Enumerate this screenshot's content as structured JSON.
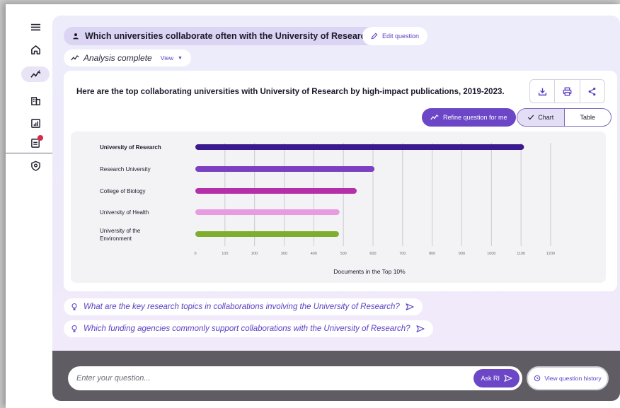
{
  "sidebar": {
    "items": [
      {
        "icon": "menu-icon"
      },
      {
        "icon": "home-icon"
      },
      {
        "icon": "analytics-icon",
        "active": true
      },
      {
        "icon": "institutions-icon"
      },
      {
        "icon": "reports-icon"
      },
      {
        "icon": "notifications-icon",
        "badge": true
      },
      {
        "icon": "support-icon"
      }
    ]
  },
  "question": {
    "text": "Which universities collaborate often with the University of Research?",
    "edit_label": "Edit question"
  },
  "analysis": {
    "status": "Analysis complete",
    "view_label": "View"
  },
  "card": {
    "title": "Here are the top collaborating universities with University of Research by high-impact publications, 2019-2023.",
    "refine_label": "Refine question for me",
    "toggle": {
      "chart_label": "Chart",
      "table_label": "Table",
      "selected": "Chart"
    }
  },
  "chart_data": {
    "type": "bar",
    "orientation": "horizontal",
    "categories": [
      "University of Research",
      "Research University",
      "College of Biology",
      "University of Health",
      "University of the Environment"
    ],
    "values": [
      1110,
      605,
      545,
      487,
      485
    ],
    "colors": [
      "#3b1a8f",
      "#7b3fc2",
      "#b52fa8",
      "#e79be1",
      "#7fae2e"
    ],
    "xlabel": "Documents in the Top 10%",
    "xlim": [
      0,
      1200
    ],
    "xticks": [
      0,
      100,
      200,
      300,
      400,
      500,
      600,
      700,
      800,
      900,
      1000,
      1100,
      1200
    ],
    "grid": true
  },
  "suggestions": [
    "What are the key research topics in collaborations involving the University of Research?",
    "Which funding agencies commonly support collaborations with the University of Research?"
  ],
  "input": {
    "placeholder": "Enter your question...",
    "ask_label": "Ask RI",
    "history_label": "View question history"
  },
  "colors": {
    "accent": "#6b47c7",
    "link": "#5b3fc4"
  }
}
